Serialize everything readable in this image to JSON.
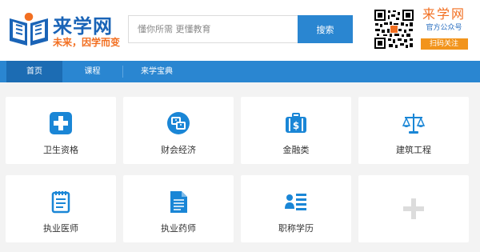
{
  "brand": {
    "name": "来学网",
    "slogan": "未来，因学而变"
  },
  "search": {
    "placeholder": "懂你所需 更懂教育",
    "button_label": "搜索"
  },
  "wechat": {
    "title": "来学网",
    "subtitle": "官方公众号",
    "button_label": "扫码关注"
  },
  "nav": {
    "items": [
      {
        "label": "首页",
        "active": true
      },
      {
        "label": "课程",
        "active": false
      },
      {
        "label": "来学宝典",
        "active": false
      }
    ]
  },
  "categories": [
    {
      "label": "卫生资格",
      "icon": "medical-cross-icon"
    },
    {
      "label": "财会经济",
      "icon": "finance-exchange-icon"
    },
    {
      "label": "金融类",
      "icon": "briefcase-money-icon"
    },
    {
      "label": "建筑工程",
      "icon": "scales-icon"
    },
    {
      "label": "执业医师",
      "icon": "notepad-icon"
    },
    {
      "label": "执业药师",
      "icon": "document-icon"
    },
    {
      "label": "职称学历",
      "icon": "profile-list-icon"
    },
    {
      "label": "",
      "icon": "add-more-icon"
    }
  ],
  "colors": {
    "primary": "#2a86d1",
    "accent": "#f26f21",
    "icon": "#1a86d6",
    "nav_active": "#1c6cb3"
  }
}
